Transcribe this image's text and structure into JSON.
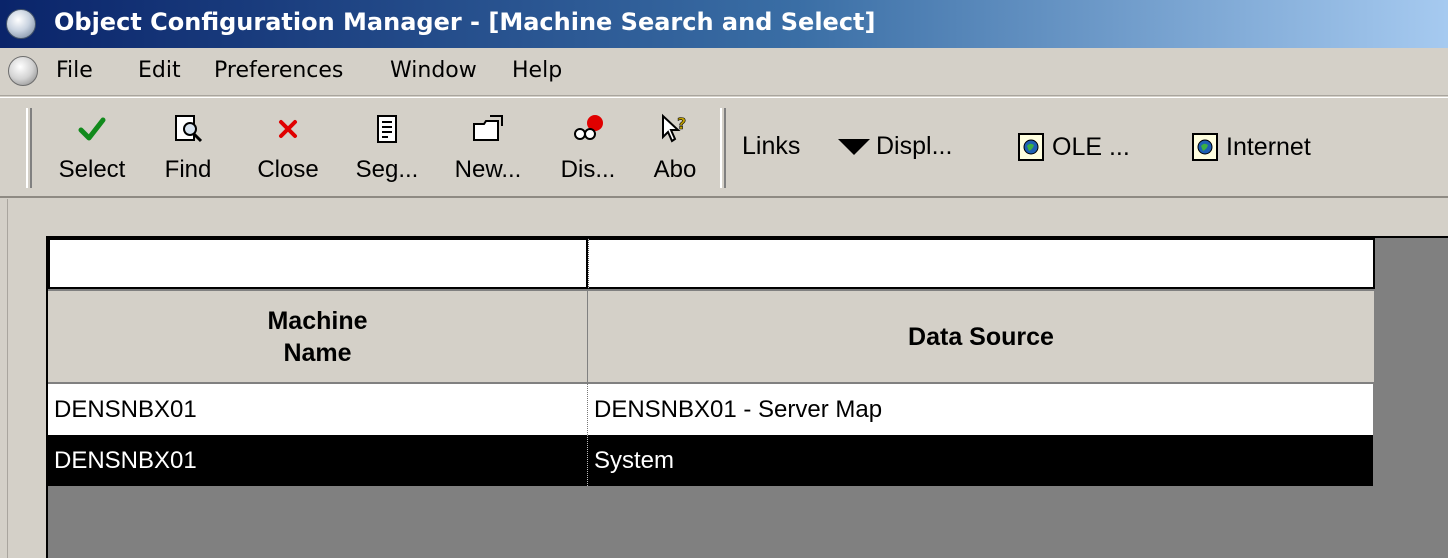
{
  "window": {
    "title": "Object Configuration Manager - [Machine Search and Select]"
  },
  "menu": [
    "File",
    "Edit",
    "Preferences",
    "Window",
    "Help"
  ],
  "toolbar": {
    "buttons": [
      {
        "label": "Select",
        "icon": "checkmark-icon"
      },
      {
        "label": "Find",
        "icon": "find-icon"
      },
      {
        "label": "Close",
        "icon": "close-icon"
      },
      {
        "label": "Seg...",
        "icon": "sequencing-icon"
      },
      {
        "label": "New...",
        "icon": "new-folder-icon"
      },
      {
        "label": "Dis...",
        "icon": "display-icon"
      },
      {
        "label": "Abo",
        "icon": "about-icon"
      }
    ],
    "links": [
      {
        "label": "Links"
      },
      {
        "label": "Displ..."
      },
      {
        "label": "OLE ..."
      },
      {
        "label": "Internet"
      }
    ]
  },
  "grid": {
    "columns": [
      "Machine Name",
      "Data Source"
    ],
    "rows": [
      {
        "machine_name": "DENSNBX01",
        "data_source": "DENSNBX01 - Server Map",
        "selected": false
      },
      {
        "machine_name": "DENSNBX01",
        "data_source": "System",
        "selected": true
      }
    ]
  },
  "colors": {
    "selected_row_bg": "#000000",
    "title_bar_start": "#0a246a",
    "title_bar_end": "#a6caf0",
    "window_bg": "#d4d0c8"
  }
}
